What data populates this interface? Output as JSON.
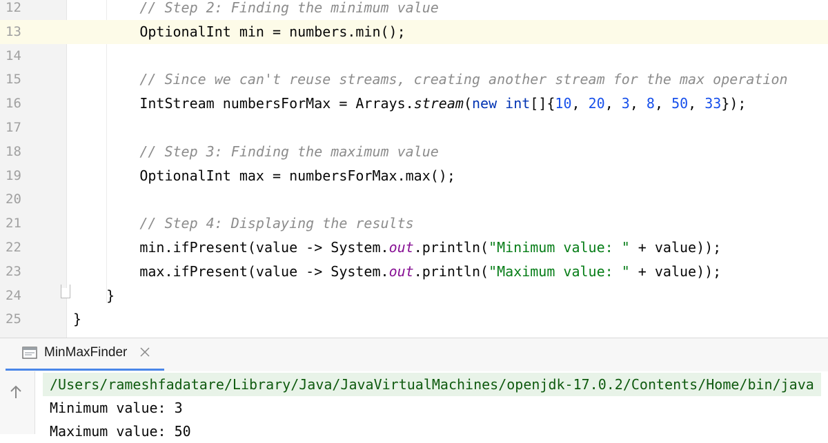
{
  "editor": {
    "active_line": "13",
    "lines": [
      {
        "num": "12",
        "segments": [
          {
            "t": "        "
          },
          {
            "t": "// Step 2: Finding the minimum value",
            "c": "cmt"
          }
        ]
      },
      {
        "num": "13",
        "segments": [
          {
            "t": "        OptionalInt min = numbers.min();"
          }
        ]
      },
      {
        "num": "14",
        "segments": []
      },
      {
        "num": "15",
        "segments": [
          {
            "t": "        "
          },
          {
            "t": "// Since we can't reuse streams, creating another stream for the max operation",
            "c": "cmt"
          }
        ]
      },
      {
        "num": "16",
        "segments": [
          {
            "t": "        IntStream numbersForMax = Arrays."
          },
          {
            "t": "stream",
            "c": "sm"
          },
          {
            "t": "("
          },
          {
            "t": "new",
            "c": "kw"
          },
          {
            "t": " "
          },
          {
            "t": "int",
            "c": "kw"
          },
          {
            "t": "[]{"
          },
          {
            "t": "10",
            "c": "num"
          },
          {
            "t": ", "
          },
          {
            "t": "20",
            "c": "num"
          },
          {
            "t": ", "
          },
          {
            "t": "3",
            "c": "num"
          },
          {
            "t": ", "
          },
          {
            "t": "8",
            "c": "num"
          },
          {
            "t": ", "
          },
          {
            "t": "50",
            "c": "num"
          },
          {
            "t": ", "
          },
          {
            "t": "33",
            "c": "num"
          },
          {
            "t": "});"
          }
        ]
      },
      {
        "num": "17",
        "segments": []
      },
      {
        "num": "18",
        "segments": [
          {
            "t": "        "
          },
          {
            "t": "// Step 3: Finding the maximum value",
            "c": "cmt"
          }
        ]
      },
      {
        "num": "19",
        "segments": [
          {
            "t": "        OptionalInt max = numbersForMax.max();"
          }
        ]
      },
      {
        "num": "20",
        "segments": []
      },
      {
        "num": "21",
        "segments": [
          {
            "t": "        "
          },
          {
            "t": "// Step 4: Displaying the results",
            "c": "cmt"
          }
        ]
      },
      {
        "num": "22",
        "segments": [
          {
            "t": "        min.ifPresent(value -> System."
          },
          {
            "t": "out",
            "c": "fld"
          },
          {
            "t": ".println("
          },
          {
            "t": "\"Minimum value: \"",
            "c": "str"
          },
          {
            "t": " + value));"
          }
        ]
      },
      {
        "num": "23",
        "segments": [
          {
            "t": "        max.ifPresent(value -> System."
          },
          {
            "t": "out",
            "c": "fld"
          },
          {
            "t": ".println("
          },
          {
            "t": "\"Maximum value: \"",
            "c": "str"
          },
          {
            "t": " + value));"
          }
        ]
      },
      {
        "num": "24",
        "segments": [
          {
            "t": "    }"
          }
        ]
      },
      {
        "num": "25",
        "segments": [
          {
            "t": "}"
          }
        ]
      }
    ]
  },
  "run_panel": {
    "tab_label": "MinMaxFinder",
    "icons": {
      "tab": "console-icon",
      "close": "close-icon",
      "scroll": "up-arrow-icon"
    },
    "output": [
      "/Users/rameshfadatare/Library/Java/JavaVirtualMachines/openjdk-17.0.2/Contents/Home/bin/java",
      "Minimum value: 3",
      "Maximum value: 50"
    ]
  }
}
